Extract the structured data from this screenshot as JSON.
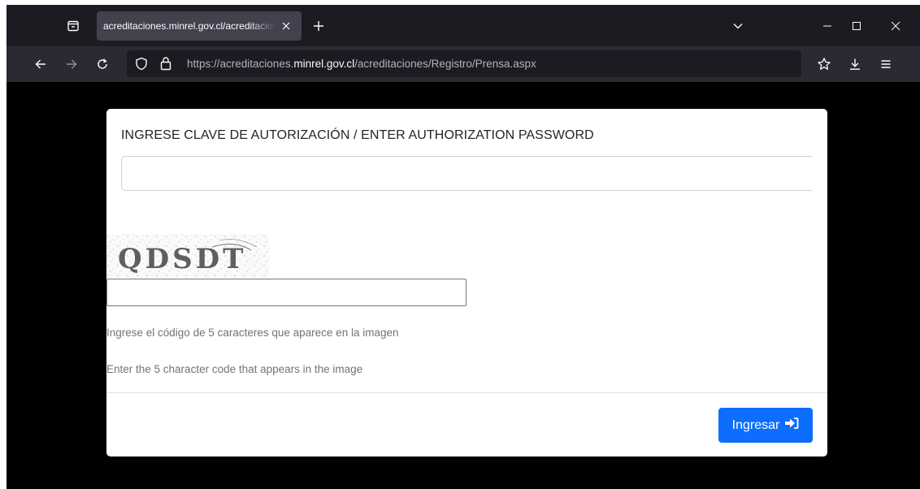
{
  "browser": {
    "tab_title": "acreditaciones.minrel.gov.cl/acreditaciones/Registro/Prensa.aspx",
    "url_prefix": "https://acreditaciones.",
    "url_host": "minrel.gov.cl",
    "url_path": "/acreditaciones/Registro/Prensa.aspx"
  },
  "modal": {
    "password_label": "INGRESE CLAVE DE AUTORIZACIÓN / ENTER AUTHORIZATION PASSWORD",
    "password_value": "",
    "captcha_code": "QDSDT",
    "captcha_value": "",
    "help_es": "Ingrese el código de 5 caracteres que aparece en la imagen",
    "help_en": "Enter the 5 character code that appears in the image",
    "submit_label": "Ingresar"
  },
  "colors": {
    "accent": "#0d6efd",
    "page_background": "#000000",
    "modal_background": "#ffffff"
  }
}
